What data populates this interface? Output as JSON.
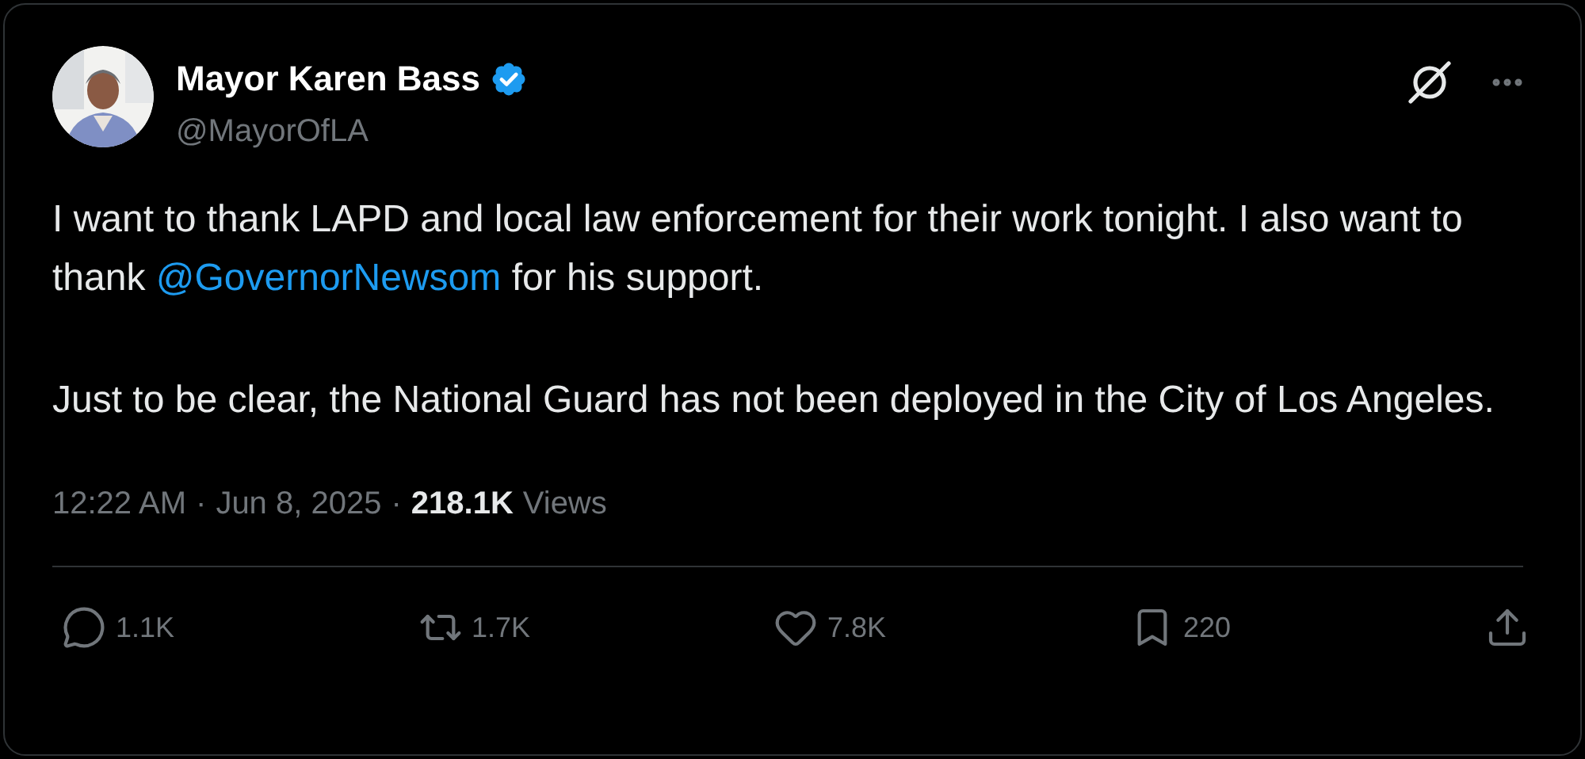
{
  "author": {
    "name": "Mayor Karen Bass",
    "handle": "@MayorOfLA",
    "verified": true
  },
  "paragraphs": [
    [
      {
        "kind": "text",
        "text": "I want to thank LAPD and local law enforcement for their work tonight. I also want to thank "
      },
      {
        "kind": "mention",
        "text": "@GovernorNewsom"
      },
      {
        "kind": "text",
        "text": " for his support."
      }
    ],
    [
      {
        "kind": "text",
        "text": "Just to be clear, the National Guard has not been deployed in the City of Los Angeles."
      }
    ]
  ],
  "meta": {
    "time": "12:22 AM",
    "separator": "·",
    "date": "Jun 8, 2025",
    "separator_2": "·",
    "views_count": "218.1K",
    "views_label": "Views"
  },
  "actions": [
    {
      "kind": "reply",
      "count": "1.1K"
    },
    {
      "kind": "repost",
      "count": "1.7K"
    },
    {
      "kind": "like",
      "count": "7.8K"
    },
    {
      "kind": "bookmark",
      "count": "220"
    },
    {
      "kind": "share"
    }
  ]
}
